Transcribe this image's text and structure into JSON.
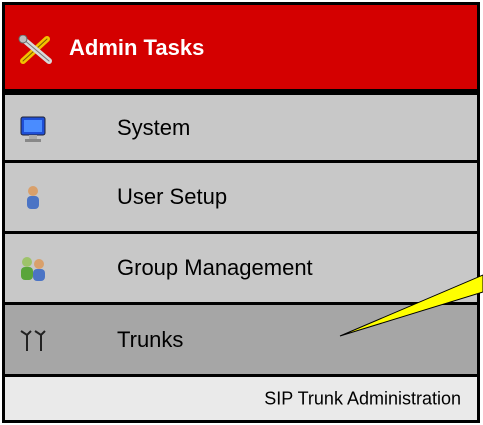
{
  "header": {
    "title": "Admin Tasks",
    "icon": "tools-icon",
    "color": "#d40000"
  },
  "menu": {
    "items": [
      {
        "label": "System",
        "icon": "monitor-icon",
        "active": false
      },
      {
        "label": "User Setup",
        "icon": "user-icon",
        "active": false
      },
      {
        "label": "Group Management",
        "icon": "group-icon",
        "active": false
      },
      {
        "label": "Trunks",
        "icon": "trunk-icon",
        "active": true
      }
    ],
    "submenu_label": "SIP Trunk Administration"
  },
  "colors": {
    "menu_bg": "#c8c8c8",
    "active_bg": "#a6a6a6",
    "submenu_bg": "#eaeaea",
    "callout": "#ffff00"
  }
}
